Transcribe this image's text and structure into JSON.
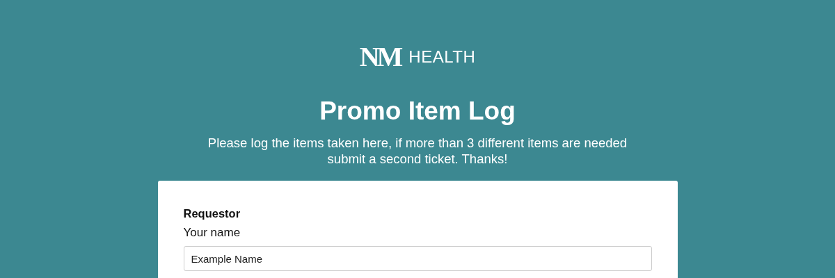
{
  "logo": {
    "monogram": "NM",
    "wordmark": "HEALTH"
  },
  "title": "Promo Item Log",
  "subtitle": "Please log the items taken here, if more than 3 different items are needed submit a second ticket. Thanks!",
  "form": {
    "section": "Requestor",
    "fields": [
      {
        "label": "Your name",
        "value": "Example Name"
      }
    ]
  }
}
